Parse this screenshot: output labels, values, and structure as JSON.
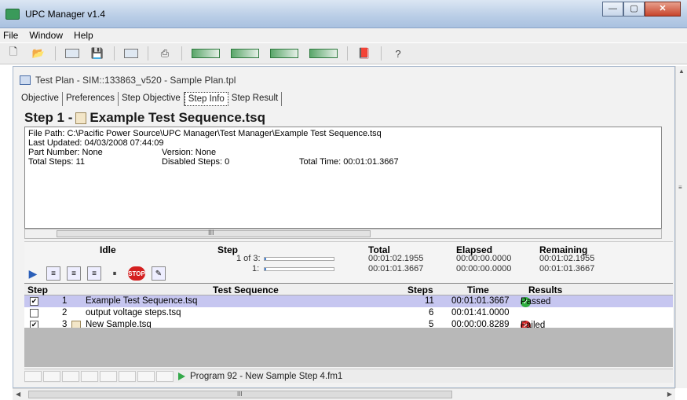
{
  "window": {
    "title": "UPC Manager v1.4",
    "min": "—",
    "max": "▢",
    "close": "✕"
  },
  "menu": [
    "File",
    "Window",
    "Help"
  ],
  "doc": {
    "title": "Test Plan - SIM::133863_v520 - Sample Plan.tpl",
    "tabs": [
      "Objective",
      "Preferences",
      "Step Objective",
      "Step Info",
      "Step Result"
    ],
    "step_label": "Step 1 -",
    "step_name": "Example Test Sequence.tsq",
    "info": {
      "file_path": "File Path: C:\\Pacific Power Source\\UPC Manager\\Test Manager\\Example Test Sequence.tsq",
      "last_updated": "Last Updated: 04/03/2008 07:44:09",
      "part_number": "Part Number: None",
      "version": "Version: None",
      "total_steps": "Total Steps: 11",
      "disabled_steps": "Disabled Steps: 0",
      "total_time": "Total Time: 00:01:01.3667"
    },
    "info_scroll_mid": "III"
  },
  "status": {
    "state": "Idle",
    "headers": {
      "step": "Step",
      "total": "Total",
      "elapsed": "Elapsed",
      "remaining": "Remaining"
    },
    "row1": {
      "step": "1 of 3:",
      "total": "00:01:02.1955",
      "elapsed": "00:00:00.0000",
      "remaining": "00:01:02.1955",
      "progress": 0.02
    },
    "row2": {
      "step": "1:",
      "total": "00:01:01.3667",
      "elapsed": "00:00:00.0000",
      "remaining": "00:01:01.3667",
      "progress": 0.02
    },
    "stop_label": "STOP"
  },
  "table": {
    "headers": {
      "step": "Step",
      "sequence": "Test Sequence",
      "steps": "Steps",
      "time": "Time",
      "results": "Results"
    },
    "rows": [
      {
        "checked": true,
        "num": "1",
        "sequence": "Example Test Sequence.tsq",
        "steps": "11",
        "time": "00:01:01.3667",
        "result": "Passed",
        "status": "passed",
        "selected": true
      },
      {
        "checked": false,
        "num": "2",
        "sequence": "output voltage steps.tsq",
        "steps": "6",
        "time": "00:01:41.0000",
        "result": "",
        "status": "",
        "selected": false
      },
      {
        "checked": true,
        "num": "3",
        "sequence": "New Sample.tsq",
        "steps": "5",
        "time": "00:00:00.8289",
        "result": "Failed",
        "status": "failed",
        "selected": false
      }
    ]
  },
  "statusbar": {
    "program": "Program 92 - New Sample Step 4.fm1"
  },
  "hscroll_mid": "III"
}
